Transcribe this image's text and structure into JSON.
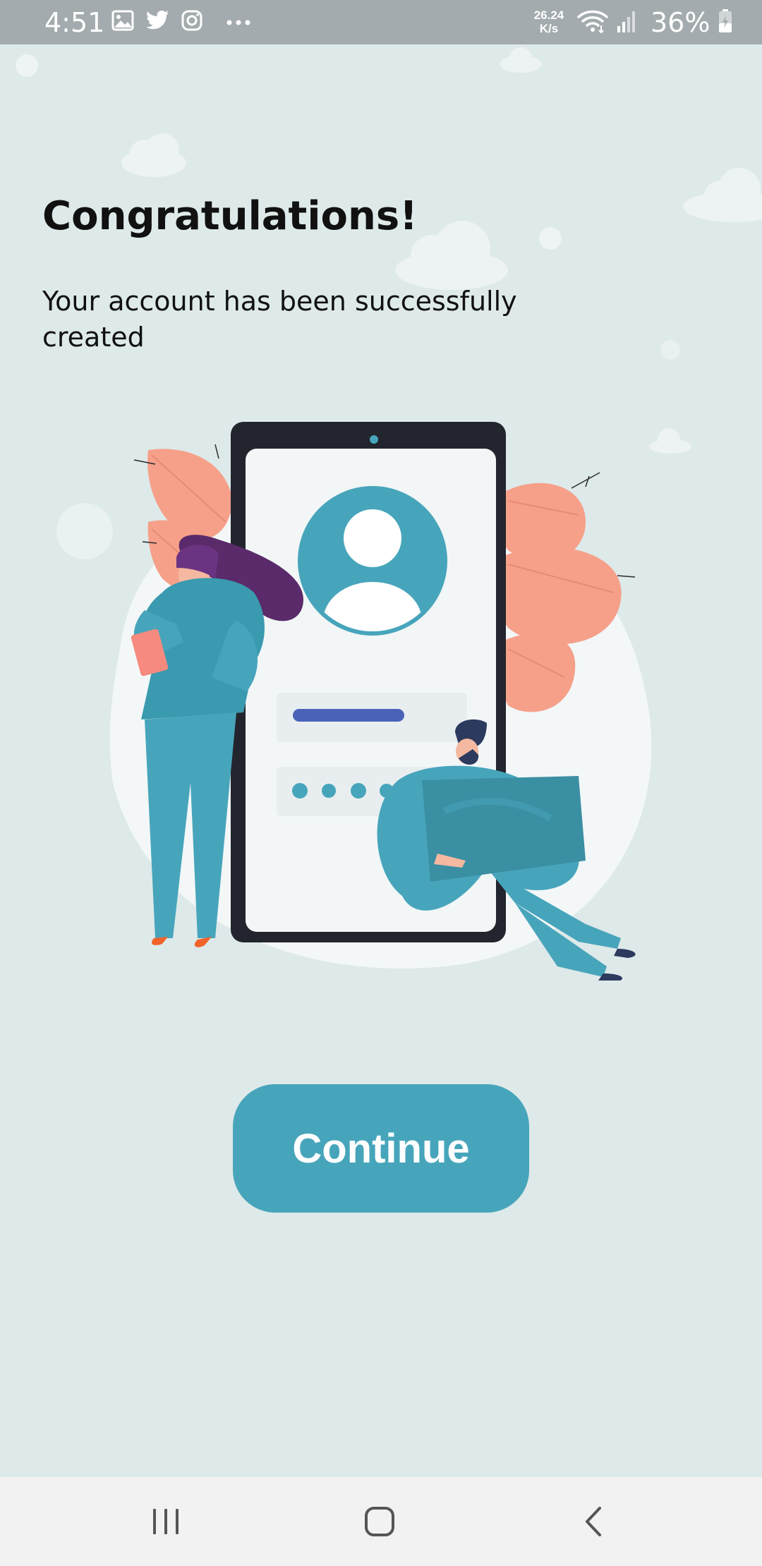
{
  "status_bar": {
    "time": "4:51",
    "network_speed_value": "26.24",
    "network_speed_unit": "K/s",
    "battery": "36%",
    "icons": [
      "image-icon",
      "twitter-icon",
      "instagram-icon",
      "more-icon",
      "wifi-icon",
      "signal-icon",
      "battery-icon"
    ]
  },
  "main": {
    "title": "Congratulations!",
    "message": "Your account has been successfully\n created",
    "continue_label": "Continue"
  },
  "illustration": {
    "name": "account-created-illustration"
  },
  "nav_bar": {
    "icons": [
      "recent-apps-icon",
      "home-icon",
      "back-icon"
    ]
  },
  "colors": {
    "background": "#dee9e9",
    "accent": "#47a5bb",
    "status_bar": "#a3abae",
    "nav_bar": "#f2f2f2",
    "leaf": "#f6a08a",
    "hair": "#5a2a6a"
  }
}
